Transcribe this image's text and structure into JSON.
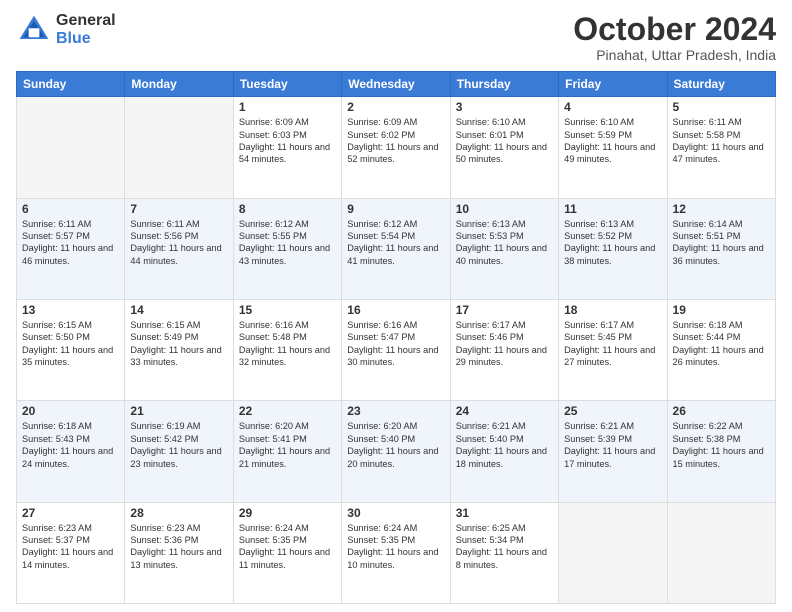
{
  "header": {
    "logo_general": "General",
    "logo_blue": "Blue",
    "month_title": "October 2024",
    "location": "Pinahat, Uttar Pradesh, India"
  },
  "weekdays": [
    "Sunday",
    "Monday",
    "Tuesday",
    "Wednesday",
    "Thursday",
    "Friday",
    "Saturday"
  ],
  "weeks": [
    [
      {
        "day": "",
        "info": ""
      },
      {
        "day": "",
        "info": ""
      },
      {
        "day": "1",
        "info": "Sunrise: 6:09 AM\nSunset: 6:03 PM\nDaylight: 11 hours and 54 minutes."
      },
      {
        "day": "2",
        "info": "Sunrise: 6:09 AM\nSunset: 6:02 PM\nDaylight: 11 hours and 52 minutes."
      },
      {
        "day": "3",
        "info": "Sunrise: 6:10 AM\nSunset: 6:01 PM\nDaylight: 11 hours and 50 minutes."
      },
      {
        "day": "4",
        "info": "Sunrise: 6:10 AM\nSunset: 5:59 PM\nDaylight: 11 hours and 49 minutes."
      },
      {
        "day": "5",
        "info": "Sunrise: 6:11 AM\nSunset: 5:58 PM\nDaylight: 11 hours and 47 minutes."
      }
    ],
    [
      {
        "day": "6",
        "info": "Sunrise: 6:11 AM\nSunset: 5:57 PM\nDaylight: 11 hours and 46 minutes."
      },
      {
        "day": "7",
        "info": "Sunrise: 6:11 AM\nSunset: 5:56 PM\nDaylight: 11 hours and 44 minutes."
      },
      {
        "day": "8",
        "info": "Sunrise: 6:12 AM\nSunset: 5:55 PM\nDaylight: 11 hours and 43 minutes."
      },
      {
        "day": "9",
        "info": "Sunrise: 6:12 AM\nSunset: 5:54 PM\nDaylight: 11 hours and 41 minutes."
      },
      {
        "day": "10",
        "info": "Sunrise: 6:13 AM\nSunset: 5:53 PM\nDaylight: 11 hours and 40 minutes."
      },
      {
        "day": "11",
        "info": "Sunrise: 6:13 AM\nSunset: 5:52 PM\nDaylight: 11 hours and 38 minutes."
      },
      {
        "day": "12",
        "info": "Sunrise: 6:14 AM\nSunset: 5:51 PM\nDaylight: 11 hours and 36 minutes."
      }
    ],
    [
      {
        "day": "13",
        "info": "Sunrise: 6:15 AM\nSunset: 5:50 PM\nDaylight: 11 hours and 35 minutes."
      },
      {
        "day": "14",
        "info": "Sunrise: 6:15 AM\nSunset: 5:49 PM\nDaylight: 11 hours and 33 minutes."
      },
      {
        "day": "15",
        "info": "Sunrise: 6:16 AM\nSunset: 5:48 PM\nDaylight: 11 hours and 32 minutes."
      },
      {
        "day": "16",
        "info": "Sunrise: 6:16 AM\nSunset: 5:47 PM\nDaylight: 11 hours and 30 minutes."
      },
      {
        "day": "17",
        "info": "Sunrise: 6:17 AM\nSunset: 5:46 PM\nDaylight: 11 hours and 29 minutes."
      },
      {
        "day": "18",
        "info": "Sunrise: 6:17 AM\nSunset: 5:45 PM\nDaylight: 11 hours and 27 minutes."
      },
      {
        "day": "19",
        "info": "Sunrise: 6:18 AM\nSunset: 5:44 PM\nDaylight: 11 hours and 26 minutes."
      }
    ],
    [
      {
        "day": "20",
        "info": "Sunrise: 6:18 AM\nSunset: 5:43 PM\nDaylight: 11 hours and 24 minutes."
      },
      {
        "day": "21",
        "info": "Sunrise: 6:19 AM\nSunset: 5:42 PM\nDaylight: 11 hours and 23 minutes."
      },
      {
        "day": "22",
        "info": "Sunrise: 6:20 AM\nSunset: 5:41 PM\nDaylight: 11 hours and 21 minutes."
      },
      {
        "day": "23",
        "info": "Sunrise: 6:20 AM\nSunset: 5:40 PM\nDaylight: 11 hours and 20 minutes."
      },
      {
        "day": "24",
        "info": "Sunrise: 6:21 AM\nSunset: 5:40 PM\nDaylight: 11 hours and 18 minutes."
      },
      {
        "day": "25",
        "info": "Sunrise: 6:21 AM\nSunset: 5:39 PM\nDaylight: 11 hours and 17 minutes."
      },
      {
        "day": "26",
        "info": "Sunrise: 6:22 AM\nSunset: 5:38 PM\nDaylight: 11 hours and 15 minutes."
      }
    ],
    [
      {
        "day": "27",
        "info": "Sunrise: 6:23 AM\nSunset: 5:37 PM\nDaylight: 11 hours and 14 minutes."
      },
      {
        "day": "28",
        "info": "Sunrise: 6:23 AM\nSunset: 5:36 PM\nDaylight: 11 hours and 13 minutes."
      },
      {
        "day": "29",
        "info": "Sunrise: 6:24 AM\nSunset: 5:35 PM\nDaylight: 11 hours and 11 minutes."
      },
      {
        "day": "30",
        "info": "Sunrise: 6:24 AM\nSunset: 5:35 PM\nDaylight: 11 hours and 10 minutes."
      },
      {
        "day": "31",
        "info": "Sunrise: 6:25 AM\nSunset: 5:34 PM\nDaylight: 11 hours and 8 minutes."
      },
      {
        "day": "",
        "info": ""
      },
      {
        "day": "",
        "info": ""
      }
    ]
  ]
}
